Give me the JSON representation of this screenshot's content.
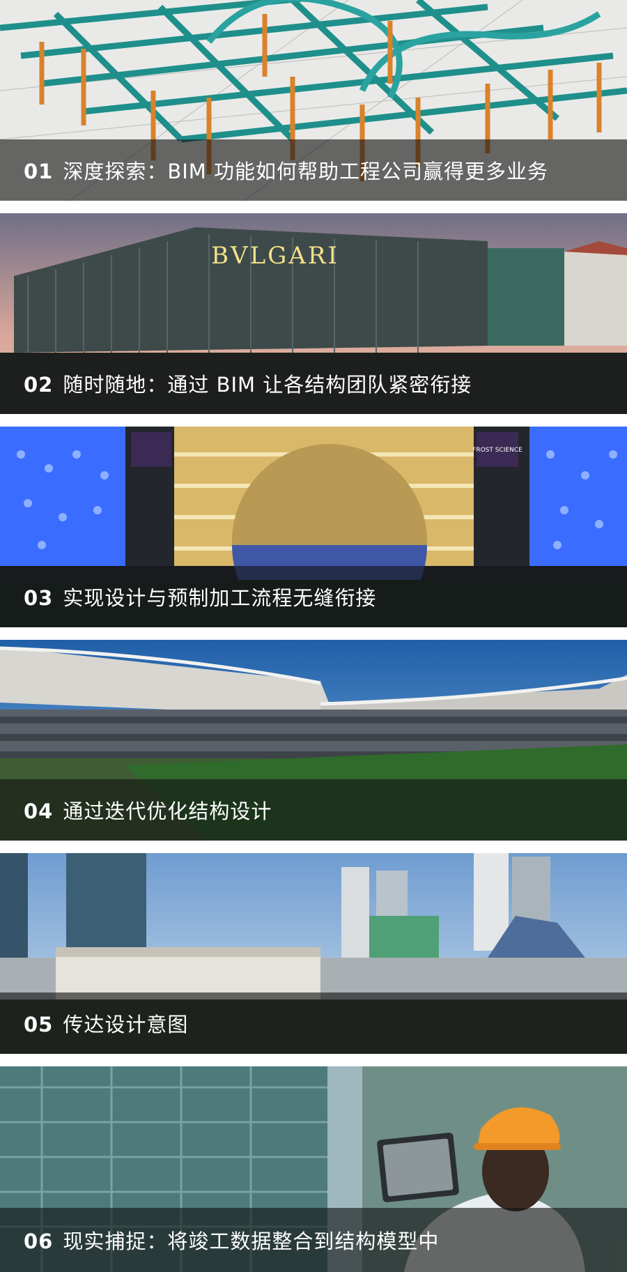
{
  "cards": [
    {
      "num": "01",
      "title": "深度探索：BIM 功能如何帮助工程公司赢得更多业务"
    },
    {
      "num": "02",
      "title": "随时随地：通过 BIM 让各结构团队紧密衔接"
    },
    {
      "num": "03",
      "title": "实现设计与预制加工流程无缝衔接"
    },
    {
      "num": "04",
      "title": "通过迭代优化结构设计"
    },
    {
      "num": "05",
      "title": "传达设计意图"
    },
    {
      "num": "06",
      "title": "现实捕捉：将竣工数据整合到结构模型中"
    }
  ],
  "images": {
    "card2_sign": "BVLGARI",
    "card3_sign": "FROST SCIENCE"
  },
  "colors": {
    "caption_bg": "#1a1a1a",
    "caption_text": "#ffffff",
    "beam_teal": "#2aa3a0",
    "column_orange": "#d9822b",
    "facade_blue": "#3a6cff",
    "helmet_orange": "#f39a2a"
  }
}
